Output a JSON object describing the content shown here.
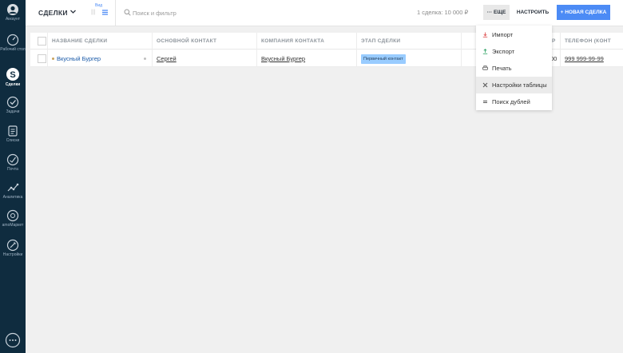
{
  "sidebar": {
    "items": [
      {
        "label": "Аккаунт",
        "icon": "account-icon"
      },
      {
        "label": "Рабочий стол",
        "icon": "dashboard-icon"
      },
      {
        "label": "Сделки",
        "icon": "deals-icon",
        "active": true
      },
      {
        "label": "Задачи",
        "icon": "tasks-icon"
      },
      {
        "label": "Списки",
        "icon": "lists-icon"
      },
      {
        "label": "Почта",
        "icon": "mail-icon"
      },
      {
        "label": "Аналитика",
        "icon": "analytics-icon"
      },
      {
        "label": "amoМаркет",
        "icon": "market-icon"
      },
      {
        "label": "Настройки",
        "icon": "settings-icon"
      }
    ],
    "chat_icon": "chat-icon"
  },
  "header": {
    "title": "СДЕЛКИ",
    "view_label": "Вид",
    "search_placeholder": "Поиск и фильтр",
    "summary": "1 сделка: 10 000 ₽",
    "more_label": "··· ЕЩЕ",
    "setup_label": "НАСТРОИТЬ",
    "new_deal_label": "+ НОВАЯ СДЕЛКА"
  },
  "table": {
    "columns": [
      "НАЗВАНИЕ СДЕЛКИ",
      "ОСНОВНОЙ КОНТАКТ",
      "КОМПАНИЯ КОНТАКТА",
      "ЭТАП СДЕЛКИ",
      "Р",
      "ТЕЛЕФОН (КОНТ"
    ],
    "rows": [
      {
        "name": "Вкусный Бургер",
        "contact": "Сергей",
        "company": "Вкусный Бургер",
        "stage": "Первичный контакт",
        "budget_tail": "00",
        "phone": "999 999-99-99"
      }
    ]
  },
  "dropdown": {
    "items": [
      {
        "label": "Импорт",
        "icon": "import-icon"
      },
      {
        "label": "Экспорт",
        "icon": "export-icon"
      },
      {
        "label": "Печать",
        "icon": "print-icon"
      },
      {
        "label": "Настройки таблицы",
        "icon": "table-settings-icon",
        "hover": true
      },
      {
        "label": "Поиск дублей",
        "icon": "duplicates-icon"
      }
    ]
  },
  "colors": {
    "sidebar_bg": "#0f2c3f",
    "accent": "#4c8bf5",
    "stage_badge": "#99ccff",
    "link": "#1a5aa8"
  }
}
